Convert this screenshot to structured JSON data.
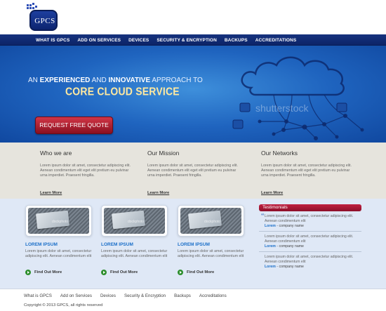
{
  "logo": {
    "text": "GPCS"
  },
  "nav": {
    "items": [
      "WHAT IS GPCS",
      "ADD ON SERVICES",
      "DEVICES",
      "SECURITY & ENCRYPTION",
      "BACKUPS",
      "ACCREDITATIONS"
    ]
  },
  "hero": {
    "line1_a": "AN ",
    "line1_b": "EXPERIENCED",
    "line1_c": " AND ",
    "line1_d": "INNOVATIVE",
    "line1_e": " APPROACH TO",
    "line2": "CORE CLOUD SERVICE",
    "cta": "REQUEST FREE QUOTE",
    "watermark": "shutterstock"
  },
  "band": {
    "columns": [
      {
        "title": "Who we are",
        "body": "Lorem ipsum dolor sit amet, consectetur adipiscing elit. Aenean condimentum elit eget elit pretium eu pulvinar urna imperdiet. Praesent fringilla.",
        "more": "Learn More"
      },
      {
        "title": "Our Mission",
        "body": "Lorem ipsum dolor sit amet, consectetur adipiscing elit. Aenean condimentum elit eget elit pretium eu pulvinar urna imperdiet. Praesent fringilla.",
        "more": "Learn More"
      },
      {
        "title": "Our Networks",
        "body": "Lorem ipsum dolor sit amet, consectetur adipiscing elit. Aenean condimentum elit eget elit pretium eu pulvinar urna imperdiet. Praesent fringilla.",
        "more": "Learn More"
      }
    ]
  },
  "cards": [
    {
      "title": "LOREM IPSUM",
      "body": "Lorem ipsum dolor sit amet, consectetur adipiscing elit. Aenean condimentum elit",
      "more": "Find Out More",
      "watermark": "dockphoto"
    },
    {
      "title": "LOREM IPSUM",
      "body": "Lorem ipsum dolor sit amet, consectetur adipiscing elit. Aenean condimentum elit",
      "more": "Find Out More",
      "watermark": "dockphoto"
    },
    {
      "title": "LOREM IPSUM",
      "body": "Lorem ipsum dolor sit amet, consectetur adipiscing elit. Aenean condimentum elit",
      "more": "Find Out More",
      "watermark": "dockphoto"
    }
  ],
  "testimonials": {
    "title": "Testimonials",
    "items": [
      {
        "body": "Lorem ipsum dolor sit amet, consectetur adipiscing elit. Aenean condimentum elit",
        "name": "Lorem",
        "company": " - company name"
      },
      {
        "body": "Lorem ipsum dolor sit amet, consectetur adipiscing elit. Aenean condimentum elit",
        "name": "Lorem",
        "company": " - company name"
      },
      {
        "body": "Lorem ipsum dolor sit amet, consectetur adipiscing elit. Aenean condimentum elit",
        "name": "Lorem",
        "company": " - company name"
      }
    ]
  },
  "footer": {
    "links": [
      "What is GPCS",
      "Add on Services",
      "Devices",
      "Security & Encryption",
      "Backups",
      "Accreditations"
    ],
    "copyright": "Copyright © 2013 GPCS, all rights reserved"
  },
  "colors": {
    "nav_bg": "#16337f",
    "hero_bg": "#1f64bf",
    "cta_bg": "#b0202f",
    "accent_blue": "#1a6ec8",
    "testimonial_head": "#b0203c",
    "band_bg": "#e6e4dd",
    "lower_bg": "#dfe8f6"
  },
  "icons": {
    "cta": "none",
    "find_more": "green-arrow-circle-icon",
    "quote": "quote-icon",
    "hero_art": "cloud-network-icon"
  }
}
